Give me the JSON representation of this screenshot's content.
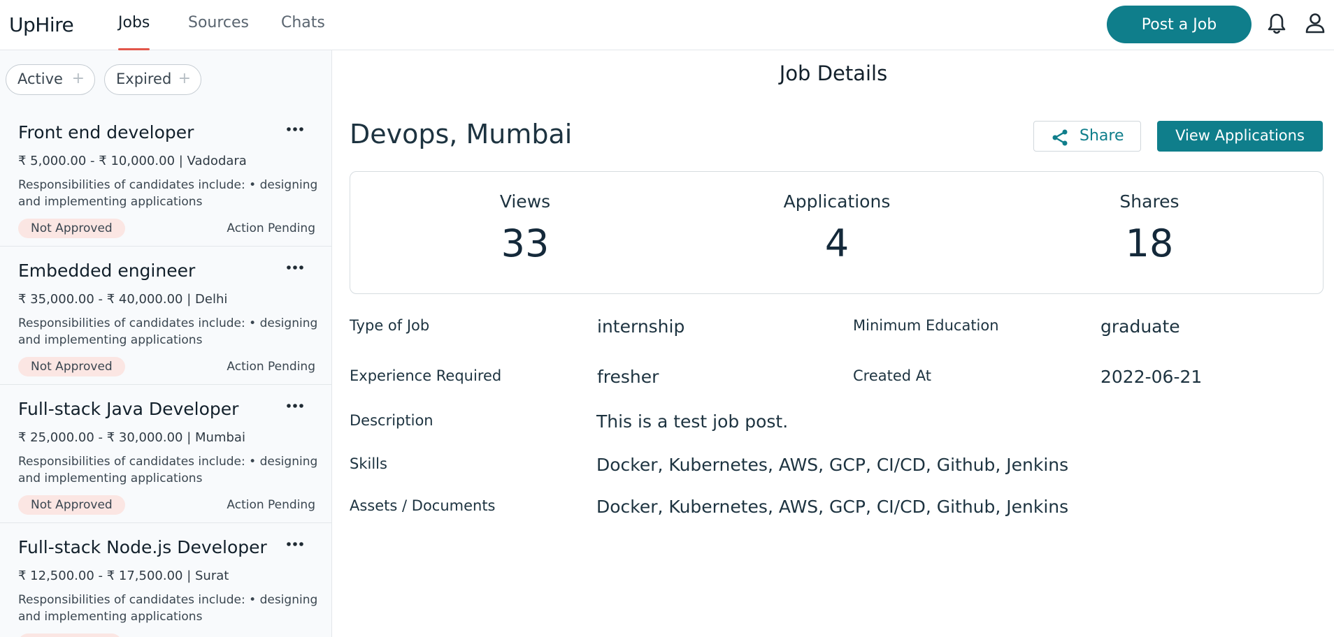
{
  "brand": "UpHire",
  "nav": {
    "tabs": [
      "Jobs",
      "Sources",
      "Chats"
    ],
    "active": "Jobs"
  },
  "header": {
    "post_job_label": "Post a Job"
  },
  "filters": [
    {
      "label": "Active",
      "icon": "plus-icon"
    },
    {
      "label": "Expired",
      "icon": "plus-icon"
    }
  ],
  "jobs": [
    {
      "title": "Front end developer",
      "meta": "₹ 5,000.00 - ₹ 10,000.00 | Vadodara",
      "desc": "Responsibilities of candidates include: • designing and implementing applications",
      "badge": "Not Approved",
      "status": "Action Pending"
    },
    {
      "title": "Embedded engineer",
      "meta": "₹ 35,000.00 - ₹ 40,000.00 | Delhi",
      "desc": "Responsibilities of candidates include: • designing and implementing applications",
      "badge": "Not Approved",
      "status": "Action Pending"
    },
    {
      "title": "Full-stack Java Developer",
      "meta": "₹ 25,000.00 - ₹ 30,000.00 | Mumbai",
      "desc": "Responsibilities of candidates include: • designing and implementing applications",
      "badge": "Not Approved",
      "status": "Action Pending"
    },
    {
      "title": "Full-stack Node.js Developer",
      "meta": "₹ 12,500.00 - ₹ 17,500.00 | Surat",
      "desc": "Responsibilities of candidates include: • designing and implementing applications",
      "badge": "",
      "status": ""
    }
  ],
  "details": {
    "title": "Job Details",
    "job_heading": "Devops, Mumbai",
    "share_label": "Share",
    "view_applications_label": "View Applications",
    "stats": [
      {
        "label": "Views",
        "value": "33"
      },
      {
        "label": "Applications",
        "value": "4"
      },
      {
        "label": "Shares",
        "value": "18"
      }
    ],
    "type_of_job_label": "Type of Job",
    "type_of_job": "internship",
    "min_education_label": "Minimum Education",
    "min_education": "graduate",
    "experience_label": "Experience Required",
    "experience": "fresher",
    "created_at_label": "Created At",
    "created_at": "2022-06-21",
    "description_label": "Description",
    "description": "This is a test job post.",
    "skills_label": "Skills",
    "skills": "Docker, Kubernetes, AWS, GCP, CI/CD, Github, Jenkins",
    "assets_label": "Assets / Documents",
    "assets": "Docker, Kubernetes, AWS, GCP, CI/CD, Github, Jenkins"
  },
  "colors": {
    "accent": "#0f7e8b",
    "tab_underline": "#e2564a",
    "badge_bg": "#fbe6e3"
  }
}
